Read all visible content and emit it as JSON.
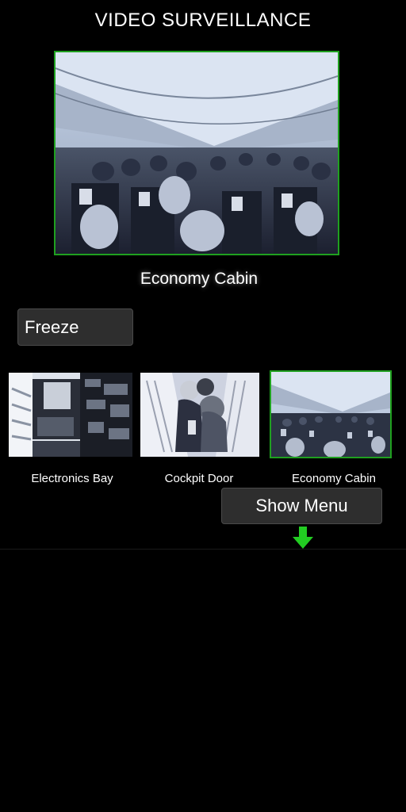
{
  "header": {
    "title": "VIDEO SURVEILLANCE"
  },
  "main_feed": {
    "caption": "Economy Cabin",
    "active_camera": "economy-cabin"
  },
  "controls": {
    "freeze_label": "Freeze",
    "show_menu_label": "Show Menu"
  },
  "cameras": [
    {
      "label": "Electronics Bay",
      "selected": false
    },
    {
      "label": "Cockpit Door",
      "selected": false
    },
    {
      "label": "Economy Cabin",
      "selected": true
    }
  ],
  "colors": {
    "accent_border": "#1fa01f",
    "arrow": "#22cc22",
    "button_bg": "#2e2e2e"
  }
}
